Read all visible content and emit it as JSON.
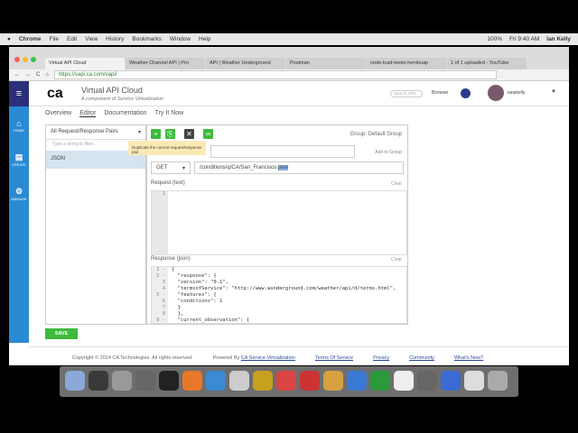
{
  "menubar": {
    "items": [
      "Chrome",
      "File",
      "Edit",
      "View",
      "History",
      "Bookmarks",
      "Window",
      "Help"
    ],
    "status": "100%",
    "clock": "Fri 9:40 AM",
    "user": "Ian Kelly"
  },
  "browser": {
    "tabs": [
      "Virtual API Cloud",
      "Weather Channel API | Pro",
      "API | Weather Underground",
      "Postman",
      "node-load-tester.herokuap",
      "1 of 1 uploaded - YouTube"
    ],
    "url": "https://vapi.ca.com/vapi/"
  },
  "sidebar": {
    "items": [
      "HOME",
      "CREATE",
      "MANAGE"
    ]
  },
  "header": {
    "logo": "ca",
    "title": "Virtual API Cloud",
    "subtitle": "A component of Service Virtualization",
    "search_placeholder": "Search APIs",
    "browse": "Browse",
    "username": "ianakelly"
  },
  "nav": {
    "tabs": [
      "Overview",
      "Editor",
      "Documentation",
      "Try It Now"
    ]
  },
  "left": {
    "selector": "All Request/Response Pairs",
    "filter_placeholder": "Type a string to filter...",
    "items": [
      "JSON"
    ]
  },
  "editor": {
    "tooltip": "Duplicate the current request/response pair",
    "group": "Group: Default Group",
    "add_to_group": "Add to Group",
    "method": "GET",
    "path": "/conditions/q/CA/San_Francisco.",
    "path_selected": "json",
    "request_label": "Request",
    "request_type": "(text)",
    "clear": "Clear",
    "response_label": "Response",
    "response_type": "(json)",
    "response_lines": [
      "{",
      "  \"response\": {",
      "  \"version\": \"0.1\",",
      "  \"termsofService\": \"http://www.wunderground.com/weather/api/d/terms.html\",",
      "  \"features\": {",
      "  \"conditions\": 1",
      "  }",
      "  },",
      "  \"current_observation\": {"
    ],
    "gutter": [
      "1 -",
      "2 -",
      "3",
      "4",
      "5 -",
      "6",
      "7",
      "8",
      "9 -"
    ]
  },
  "save": "SAVE",
  "footer": {
    "copyright": "Copyright © 2014 CA Technologies. All rights reserved.",
    "powered": "Powered By",
    "powered_link": "CA Service Virtualization",
    "links": [
      "Terms Of Service",
      "Privacy",
      "Community",
      "What's New?"
    ]
  },
  "colors": {
    "accent": "#2a8ad4",
    "green": "#3dbb3d",
    "nav_dark": "#2c2f7a"
  }
}
